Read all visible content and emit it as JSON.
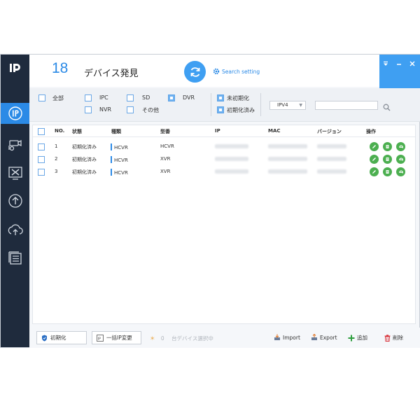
{
  "header": {
    "count": "18",
    "title": "デバイス発見",
    "search_setting": "Search setting"
  },
  "filter": {
    "all": "全部",
    "ipc": "IPC",
    "sd": "SD",
    "dvr": "DVR",
    "nvr": "NVR",
    "other": "その他",
    "uninitialized": "未初期化",
    "initialized": "初期化済み",
    "ip_version": "IPV4",
    "search_value": ""
  },
  "table": {
    "columns": {
      "no": "NO.",
      "status": "状態",
      "type": "種類",
      "model": "型番",
      "ip": "IP",
      "mac": "MAC",
      "version": "バージョン",
      "operation": "操作"
    },
    "rows": [
      {
        "no": "1",
        "status": "初期化済み",
        "type": "HCVR",
        "model": "HCVR"
      },
      {
        "no": "2",
        "status": "初期化済み",
        "type": "HCVR",
        "model": "XVR"
      },
      {
        "no": "3",
        "status": "初期化済み",
        "type": "HCVR",
        "model": "XVR"
      }
    ]
  },
  "footer": {
    "initialize": "初期化",
    "batch_ip": "一括IP変更",
    "selected_count": "0",
    "selected_label": "台デバイス選択中",
    "import": "Import",
    "export": "Export",
    "add": "追加",
    "delete": "削除"
  },
  "colors": {
    "accent": "#2b8ae6",
    "sidebar": "#1f2b3d",
    "action_green": "#4caf50",
    "delete_red": "#d9363e"
  }
}
